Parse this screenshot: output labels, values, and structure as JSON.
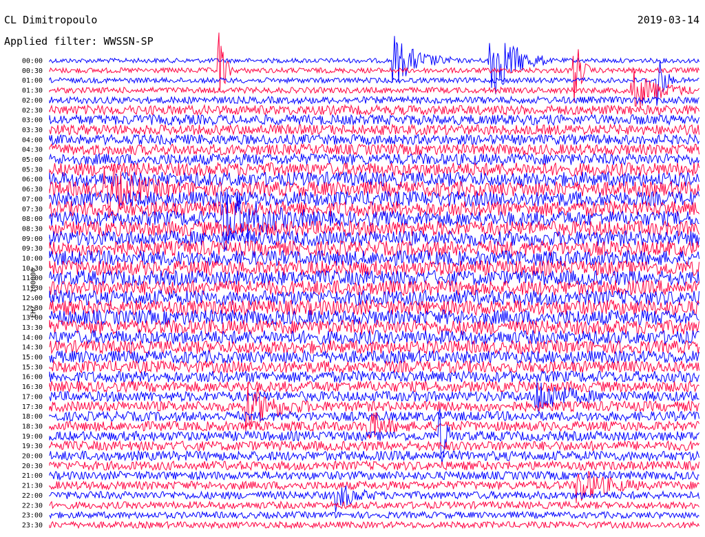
{
  "header": {
    "station": "CL Dimitropoulo",
    "filter": "Applied filter: WWSSN-SP",
    "date": "2019-03-14"
  },
  "chart_data": {
    "type": "line",
    "ylabel": "EHZ - 100000",
    "categories": [
      "00:00",
      "00:30",
      "01:00",
      "01:30",
      "02:00",
      "02:30",
      "03:00",
      "03:30",
      "04:00",
      "04:30",
      "05:00",
      "05:30",
      "06:00",
      "06:30",
      "07:00",
      "07:30",
      "08:00",
      "08:30",
      "09:00",
      "09:30",
      "10:00",
      "10:30",
      "11:00",
      "11:30",
      "12:00",
      "12:30",
      "13:00",
      "13:30",
      "14:00",
      "14:30",
      "15:00",
      "15:30",
      "16:00",
      "16:30",
      "17:00",
      "17:30",
      "18:00",
      "18:30",
      "19:00",
      "19:30",
      "20:00",
      "20:30",
      "21:00",
      "21:30",
      "22:00",
      "22:30",
      "23:00",
      "23:30"
    ],
    "colors": [
      "#0000ff",
      "#ff0040"
    ],
    "series": [
      {
        "noise": [
          0.15,
          0.2,
          0.2,
          0.25,
          0.35,
          0.55,
          0.6,
          0.6,
          0.6,
          0.65,
          0.7,
          0.85,
          0.95,
          1.0,
          1.0,
          1.0,
          1.0,
          1.0,
          1.0,
          1.0,
          1.0,
          1.0,
          1.0,
          1.0,
          1.0,
          1.0,
          1.0,
          0.95,
          0.9,
          0.85,
          0.8,
          0.75,
          0.7,
          0.65,
          0.6,
          0.6,
          0.55,
          0.55,
          0.55,
          0.55,
          0.55,
          0.5,
          0.45,
          0.45,
          0.4,
          0.35,
          0.3,
          0.3
        ]
      }
    ]
  }
}
